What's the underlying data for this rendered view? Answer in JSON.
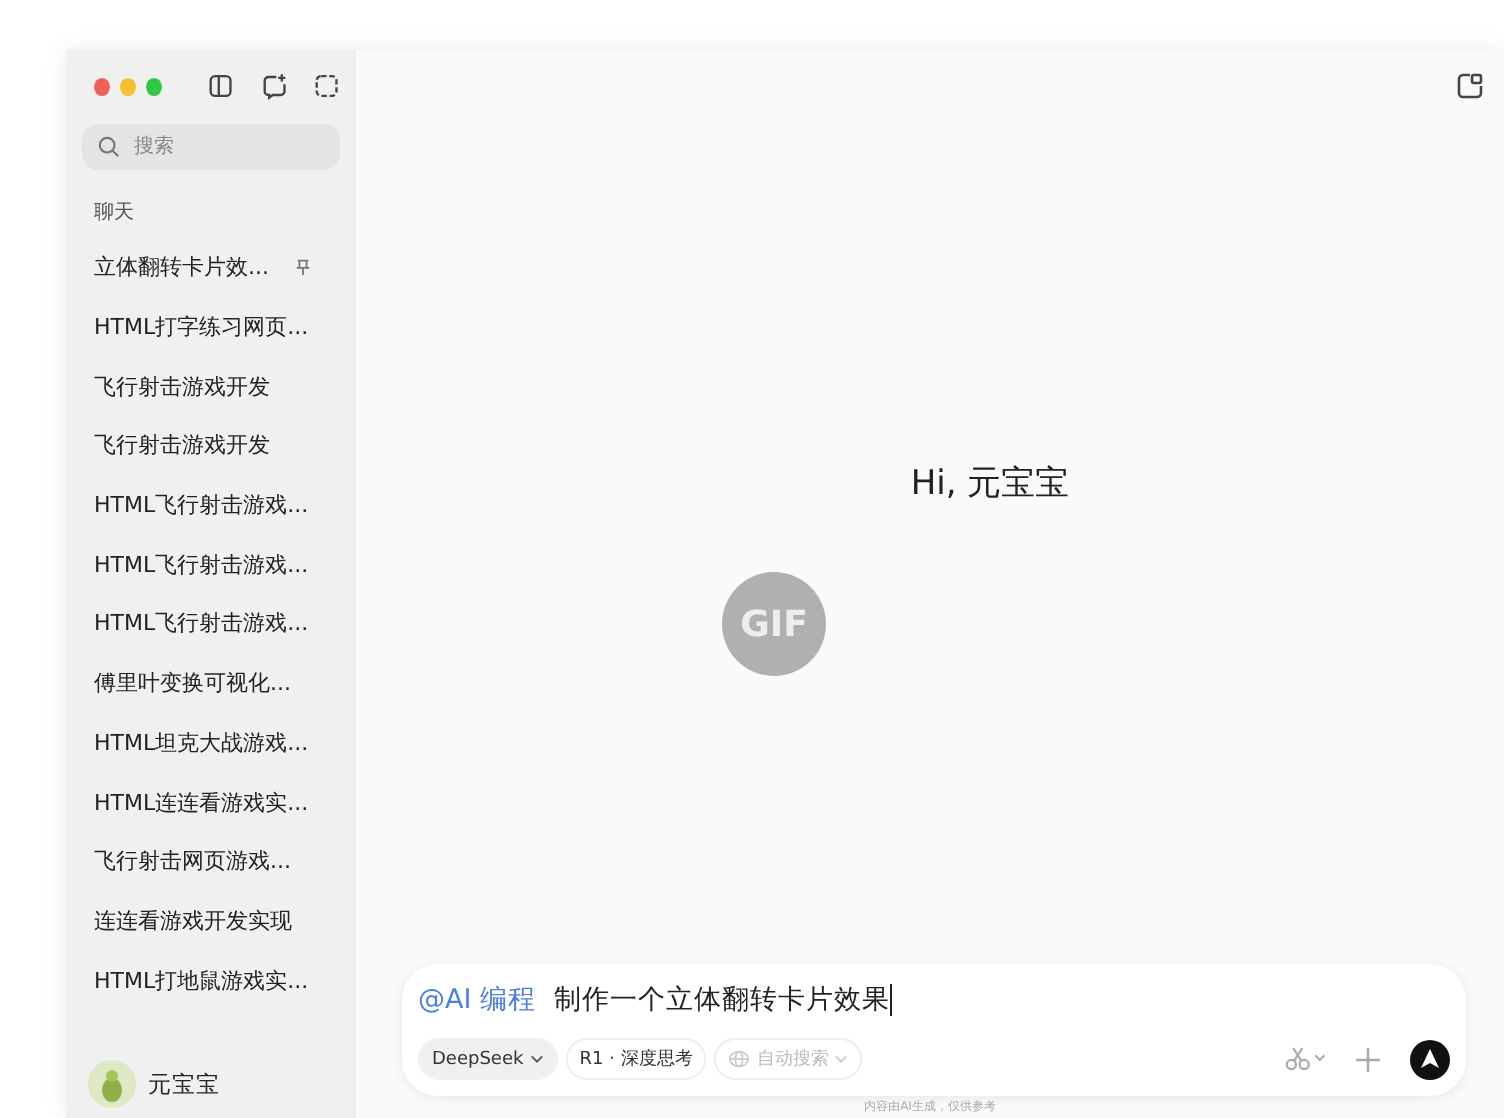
{
  "sidebar": {
    "search": {
      "placeholder": "搜索"
    },
    "section_title": "聊天",
    "chats": [
      {
        "title": "立体翻转卡片效...",
        "pinned": true
      },
      {
        "title": "HTML打字练习网页...",
        "pinned": false
      },
      {
        "title": "飞行射击游戏开发",
        "pinned": false
      },
      {
        "title": "飞行射击游戏开发",
        "pinned": false
      },
      {
        "title": "HTML飞行射击游戏...",
        "pinned": false
      },
      {
        "title": "HTML飞行射击游戏...",
        "pinned": false
      },
      {
        "title": "HTML飞行射击游戏...",
        "pinned": false
      },
      {
        "title": "傅里叶变换可视化...",
        "pinned": false
      },
      {
        "title": "HTML坦克大战游戏...",
        "pinned": false
      },
      {
        "title": "HTML连连看游戏实...",
        "pinned": false
      },
      {
        "title": "飞行射击网页游戏...",
        "pinned": false
      },
      {
        "title": "连连看游戏开发实现",
        "pinned": false
      },
      {
        "title": "HTML打地鼠游戏实...",
        "pinned": false
      }
    ],
    "user": {
      "name": "元宝宝"
    }
  },
  "main": {
    "greeting": "Hi, 元宝宝",
    "gif_badge": "GIF",
    "composer": {
      "mention": "@AI 编程",
      "value": "制作一个立体翻转卡片效果",
      "chips": [
        {
          "label": "DeepSeek",
          "kind": "dropdown",
          "disabled": false
        },
        {
          "label": "R1 · 深度思考",
          "kind": "toggle",
          "disabled": false
        },
        {
          "label": "自动搜索",
          "kind": "web",
          "disabled": true
        }
      ]
    },
    "footer": "内容由AI生成，仅供参考"
  }
}
